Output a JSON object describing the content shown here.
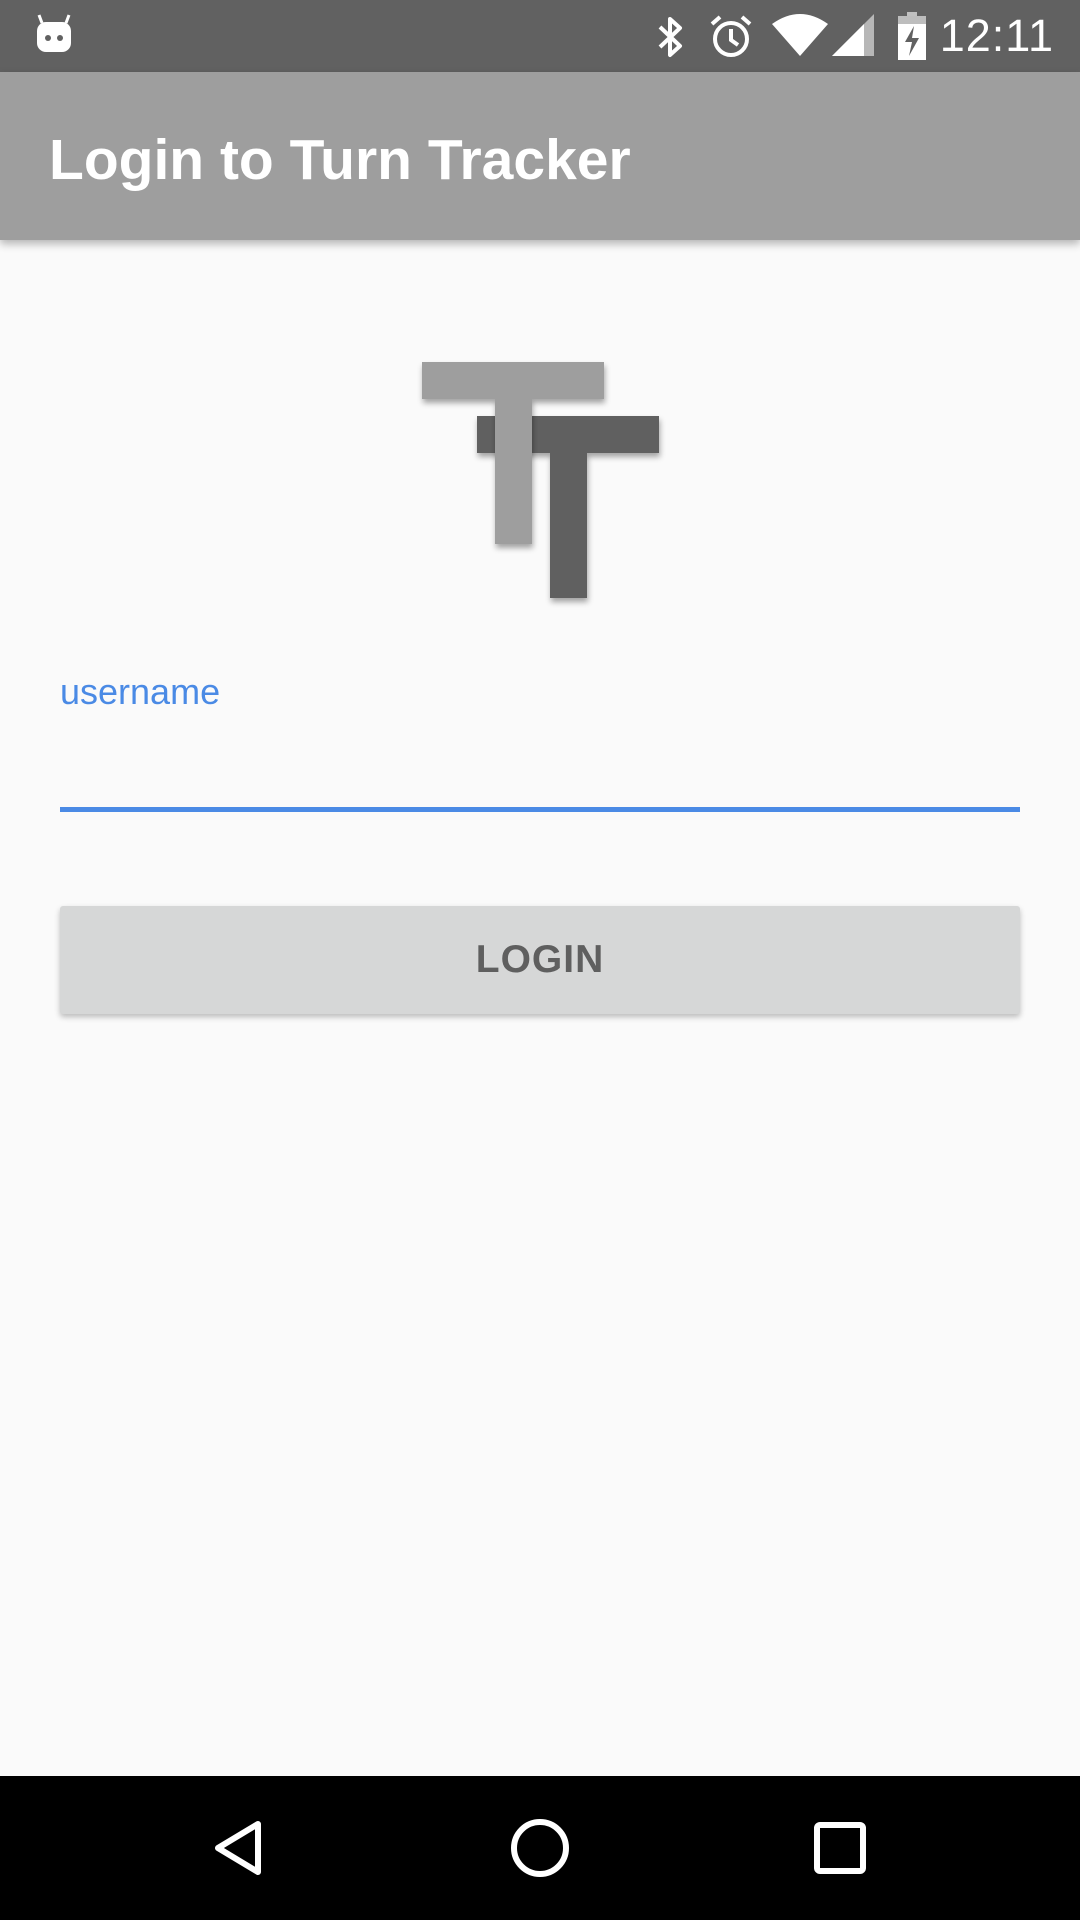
{
  "status_bar": {
    "time": "12:11",
    "icons": [
      "android-notification-icon",
      "bluetooth-icon",
      "alarm-icon",
      "wifi-icon",
      "cell-signal-icon",
      "battery-charging-icon"
    ]
  },
  "app_bar": {
    "title": "Login to Turn Tracker"
  },
  "logo": {
    "icon": "turn-tracker-logo",
    "colors": {
      "front_t": "#9e9e9e",
      "back_t": "#616161"
    }
  },
  "login_form": {
    "username_label": "username",
    "username_value": "",
    "login_button_label": "LOGIN"
  },
  "nav_bar": {
    "icons": [
      "back-icon",
      "home-icon",
      "recents-icon"
    ]
  },
  "colors": {
    "accent": "#4a8ae5",
    "app_bar": "#9e9e9e",
    "status_bar": "#616161",
    "background": "#fafafa",
    "button": "#d6d7d7"
  }
}
